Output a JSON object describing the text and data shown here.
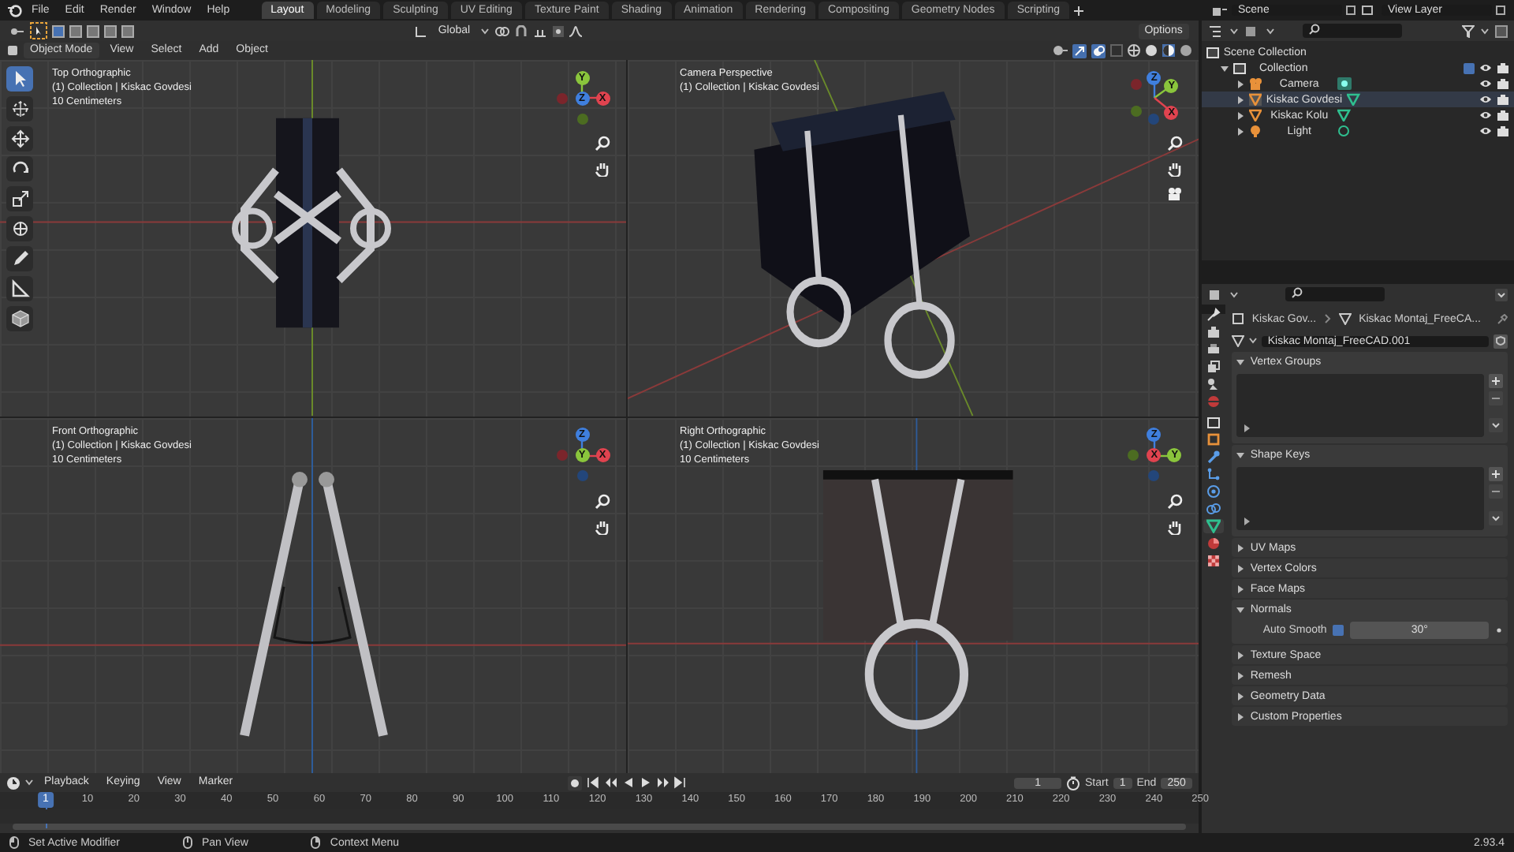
{
  "menu": [
    "File",
    "Edit",
    "Render",
    "Window",
    "Help"
  ],
  "workspaces": [
    {
      "label": "Layout",
      "selected": true
    },
    {
      "label": "Modeling",
      "selected": false
    },
    {
      "label": "Sculpting",
      "selected": false
    },
    {
      "label": "UV Editing",
      "selected": false
    },
    {
      "label": "Texture Paint",
      "selected": false
    },
    {
      "label": "Shading",
      "selected": false
    },
    {
      "label": "Animation",
      "selected": false
    },
    {
      "label": "Rendering",
      "selected": false
    },
    {
      "label": "Compositing",
      "selected": false
    },
    {
      "label": "Geometry Nodes",
      "selected": false
    },
    {
      "label": "Scripting",
      "selected": false
    }
  ],
  "scene": "Scene",
  "view_layer": "View Layer",
  "tool_header": {
    "orientation": "Global",
    "options": "Options"
  },
  "view_header": {
    "mode": "Object Mode",
    "menus": [
      "View",
      "Select",
      "Add",
      "Object"
    ]
  },
  "tools": [
    {
      "kind": "select",
      "selected": true
    },
    {
      "kind": "cursor",
      "selected": false
    },
    {
      "kind": "move",
      "selected": false
    },
    {
      "kind": "rotate",
      "selected": false
    },
    {
      "kind": "scale",
      "selected": false
    },
    {
      "kind": "transform",
      "selected": false
    },
    {
      "kind": "annotate",
      "selected": false
    },
    {
      "kind": "measure",
      "selected": false
    },
    {
      "kind": "add_cube",
      "selected": false
    }
  ],
  "viewports": [
    {
      "kind": "top",
      "title": "Top Orthographic",
      "collection": "(1) Collection | Kiskac Govdesi",
      "scale": "10 Centimeters",
      "gizmo": [
        {
          "label": "Y",
          "color": "#8ac53c",
          "kind": "top"
        },
        {
          "label": "X",
          "color": "#e0434f",
          "kind": "right"
        },
        {
          "label": "Z",
          "color": "#3f7fde",
          "kind": "center"
        }
      ]
    },
    {
      "kind": "camera",
      "title": "Camera Perspective",
      "collection": "(1) Collection | Kiskac Govdesi",
      "camera_button": true,
      "gizmo": [
        {
          "label": "Z",
          "color": "#3f7fde",
          "kind": "top"
        },
        {
          "label": "Y",
          "color": "#8ac53c",
          "kind": "upright"
        },
        {
          "label": "X",
          "color": "#e0434f",
          "kind": "downright"
        }
      ]
    },
    {
      "kind": "front",
      "title": "Front Orthographic",
      "collection": "(1) Collection | Kiskac Govdesi",
      "scale": "10 Centimeters",
      "gizmo": [
        {
          "label": "Z",
          "color": "#3f7fde",
          "kind": "top"
        },
        {
          "label": "X",
          "color": "#e0434f",
          "kind": "right"
        },
        {
          "label": "Y",
          "color": "#8ac53c",
          "kind": "center"
        }
      ]
    },
    {
      "kind": "right",
      "title": "Right Orthographic",
      "collection": "(1) Collection | Kiskac Govdesi",
      "scale": "10 Centimeters",
      "gizmo": [
        {
          "label": "Z",
          "color": "#3f7fde",
          "kind": "top"
        },
        {
          "label": "Y",
          "color": "#8ac53c",
          "kind": "right"
        },
        {
          "label": "X",
          "color": "#e0434f",
          "kind": "center"
        }
      ]
    }
  ],
  "outliner": {
    "root": "Scene Collection",
    "items": [
      {
        "label": "Collection",
        "kind": "collection",
        "checked": true,
        "expanded": true,
        "active": false,
        "children": [
          {
            "label": "Camera",
            "kind": "camera",
            "expanded": false,
            "active": false
          },
          {
            "label": "Kiskac Govdesi",
            "kind": "mesh",
            "expanded": false,
            "active": true
          },
          {
            "label": "Kiskac Kolu",
            "kind": "mesh",
            "expanded": false,
            "active": false
          },
          {
            "label": "Light",
            "kind": "light",
            "expanded": false,
            "active": false
          }
        ]
      }
    ]
  },
  "properties": {
    "tabs": [
      {
        "kind": "tool",
        "selected": false
      },
      {
        "kind": "render",
        "selected": false
      },
      {
        "kind": "output",
        "selected": false
      },
      {
        "kind": "view_layer",
        "selected": false
      },
      {
        "kind": "scene",
        "selected": false
      },
      {
        "kind": "world",
        "selected": false
      },
      {
        "kind": "collection",
        "selected": false
      },
      {
        "kind": "object",
        "selected": false
      },
      {
        "kind": "modifiers",
        "selected": false
      },
      {
        "kind": "particles",
        "selected": false
      },
      {
        "kind": "physics",
        "selected": false
      },
      {
        "kind": "constraints",
        "selected": false
      },
      {
        "kind": "data",
        "selected": true
      },
      {
        "kind": "material",
        "selected": false
      },
      {
        "kind": "texture",
        "selected": false
      }
    ],
    "breadcrumb": [
      "Kiskac Gov...",
      "Kiskac Montaj_FreeCA..."
    ],
    "mesh_name": "Kiskac Montaj_FreeCAD.001",
    "panels": [
      {
        "title": "Vertex Groups",
        "kind": "list",
        "expanded": true
      },
      {
        "title": "Shape Keys",
        "kind": "list",
        "expanded": true
      },
      {
        "title": "UV Maps",
        "kind": "plain",
        "expanded": false
      },
      {
        "title": "Vertex Colors",
        "kind": "plain",
        "expanded": false
      },
      {
        "title": "Face Maps",
        "kind": "plain",
        "expanded": false
      },
      {
        "title": "Normals",
        "kind": "normals",
        "expanded": true,
        "auto_smooth": {
          "label": "Auto Smooth",
          "checked": true,
          "angle": "30°"
        }
      },
      {
        "title": "Texture Space",
        "kind": "plain",
        "expanded": false
      },
      {
        "title": "Remesh",
        "kind": "plain",
        "expanded": false
      },
      {
        "title": "Geometry Data",
        "kind": "plain",
        "expanded": false
      },
      {
        "title": "Custom Properties",
        "kind": "plain",
        "expanded": false
      }
    ]
  },
  "timeline": {
    "menus": [
      "Playback",
      "Keying",
      "View",
      "Marker"
    ],
    "current_frame": "1",
    "start_label": "Start",
    "start": "1",
    "end_label": "End",
    "end": "250",
    "ruler": {
      "current": "1",
      "ticks": [
        "10",
        "20",
        "30",
        "40",
        "50",
        "60",
        "70",
        "80",
        "90",
        "100",
        "110",
        "120",
        "130",
        "140",
        "150",
        "160",
        "170",
        "180",
        "190",
        "200",
        "210",
        "220",
        "230",
        "240",
        "250"
      ]
    }
  },
  "status_bar": {
    "hints": [
      "Set Active Modifier",
      "Pan View",
      "Context Menu"
    ],
    "version": "2.93.4"
  }
}
